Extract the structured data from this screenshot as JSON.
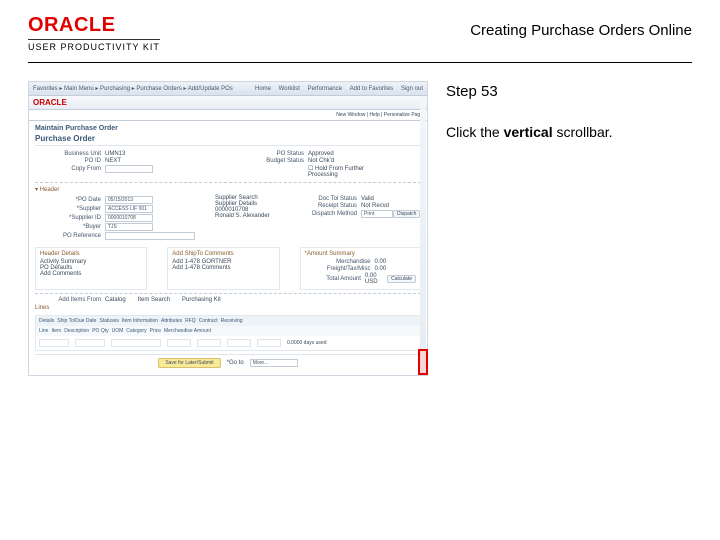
{
  "brand": {
    "logo": "ORACLE",
    "sub": "USER PRODUCTIVITY KIT"
  },
  "doc_title": "Creating Purchase Orders Online",
  "instructions": {
    "step_label": "Step 53",
    "pre_text": "Click the ",
    "bold_text": "vertical",
    "post_text": " scrollbar."
  },
  "shot": {
    "breadcrumb": "Favorites  ▸  Main Menu  ▸  Purchasing  ▸  Purchase Orders  ▸  Add/Update POs",
    "menu": [
      "Home",
      "Worklist",
      "Performance",
      "Add to Favorites",
      "Sign out"
    ],
    "logo": "ORACLE",
    "thirdbar": "New Window | Help | Personalize Page",
    "title1": "Maintain Purchase Order",
    "title2": "Purchase Order",
    "left_rows": [
      {
        "label": "Business Unit",
        "value": "UMN13"
      },
      {
        "label": "PO ID",
        "value": "NEXT"
      },
      {
        "label": "Copy From",
        "value": ""
      }
    ],
    "right_rows": [
      {
        "label": "PO Status",
        "value": "Approved"
      },
      {
        "label": "Budget Status",
        "value": "Not Chk'd"
      },
      {
        "label": "",
        "value": "☐ Hold From Further Processing"
      }
    ],
    "header_label": "▾ Header",
    "header_left": [
      {
        "label": "*PO Date",
        "value": "05/15/2013"
      },
      {
        "label": "*Supplier",
        "value": "ACCESS LIF 001"
      },
      {
        "label": "*Supplier ID",
        "value": "0000010708"
      },
      {
        "label": "*Buyer",
        "value": "TJS"
      },
      {
        "label": "PO Reference",
        "value": ""
      }
    ],
    "header_mid": [
      "Supplier Search",
      "Supplier Details",
      "0000010708",
      "Ronald S. Alexander"
    ],
    "header_right": [
      {
        "label": "Doc Tol Status",
        "value": "Valid"
      },
      {
        "label": "Receipt Status",
        "value": "Not Recvd"
      },
      {
        "label": "Dispatch Method",
        "value": "Print"
      }
    ],
    "header_btn": "Dispatch",
    "sub1": {
      "hdr": "Header Details",
      "lines": [
        "Activity Summary",
        "PO Defaults",
        "Add Comments"
      ]
    },
    "sub2": {
      "hdr": "Add ShipTo Comments",
      "lines": [
        "Add 1-478 GORTNER",
        "Add 1-478 Comments"
      ]
    },
    "summary": {
      "hdr": "*Amount Summary",
      "lines": [
        {
          "label": "Merchandise",
          "value": "0.00"
        },
        {
          "label": "Freight/Tax/Misc",
          "value": "0.00"
        },
        {
          "label": "Total Amount",
          "value": "0.00  USD"
        }
      ],
      "btn": "Calculate"
    },
    "additems_label": "Add Items From",
    "additems_links": [
      "Catalog",
      "Item Search",
      "Purchasing Kit"
    ],
    "lines": {
      "label": "Lines",
      "tabs": [
        "Details",
        "Ship To/Due Date",
        "Statuses",
        "Item Information",
        "Attributes",
        "RFQ",
        "Contract",
        "Receiving"
      ],
      "cols": [
        "Line",
        "Item",
        "Description",
        "PO Qty",
        "UOM",
        "Category",
        "Price",
        "Merchandise Amount"
      ],
      "amount_cell": "0.0000 days used"
    },
    "footer": {
      "btn": "Save for Later/Submit",
      "sel_label": "*Go to",
      "sel_value": "More..."
    }
  }
}
